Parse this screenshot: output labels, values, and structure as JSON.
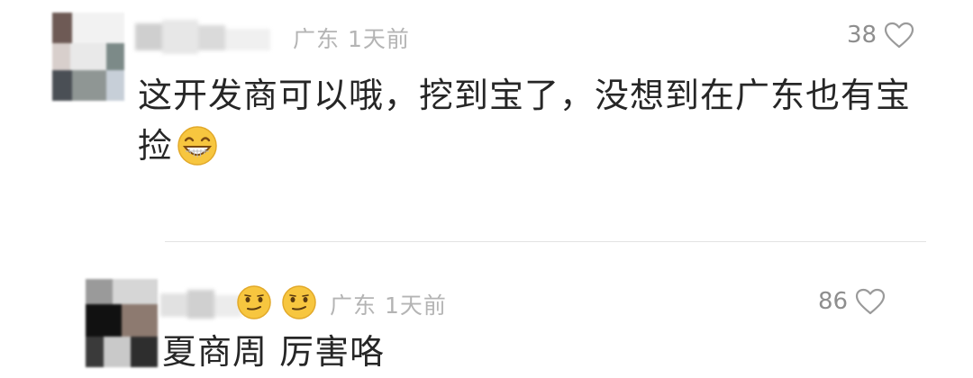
{
  "comments": [
    {
      "location": "广东",
      "time": "1天前",
      "likes": "38",
      "body_line1": "这开发商可以哦，挖到宝了，没想到在广东也有宝",
      "body_line2": "捡",
      "emoji": "grinning-emoji"
    },
    {
      "location": "广东",
      "time": "1天前",
      "likes": "86",
      "body": "夏商周 厉害咯",
      "username_emojis": [
        "smirk-emoji",
        "smirk-emoji"
      ]
    }
  ],
  "colors": {
    "meta_text": "#b4b4b4",
    "like_text": "#8e8e8e",
    "body_text": "#262626",
    "divider": "#e3e3e3",
    "emoji_yellow": "#f7c63f"
  }
}
